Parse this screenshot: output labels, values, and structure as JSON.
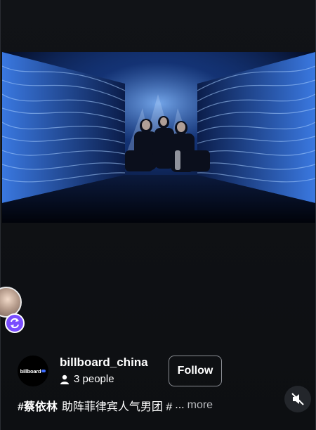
{
  "post": {
    "author_name": "billboard_china",
    "audience_count": "3 people",
    "follow_label": "Follow",
    "logo_text": "billboard",
    "caption_tag": "#蔡依林",
    "caption_text": "助阵菲律宾人气男团 #",
    "caption_ellipsis": "...",
    "more_label": "more"
  },
  "icons": {
    "person": "person-icon",
    "repost": "repost-icon",
    "mute": "speaker-muted-icon"
  },
  "colors": {
    "background": "#0e1013",
    "repost_badge": "#7a4dff",
    "video_blue": "#2f6bd8"
  }
}
